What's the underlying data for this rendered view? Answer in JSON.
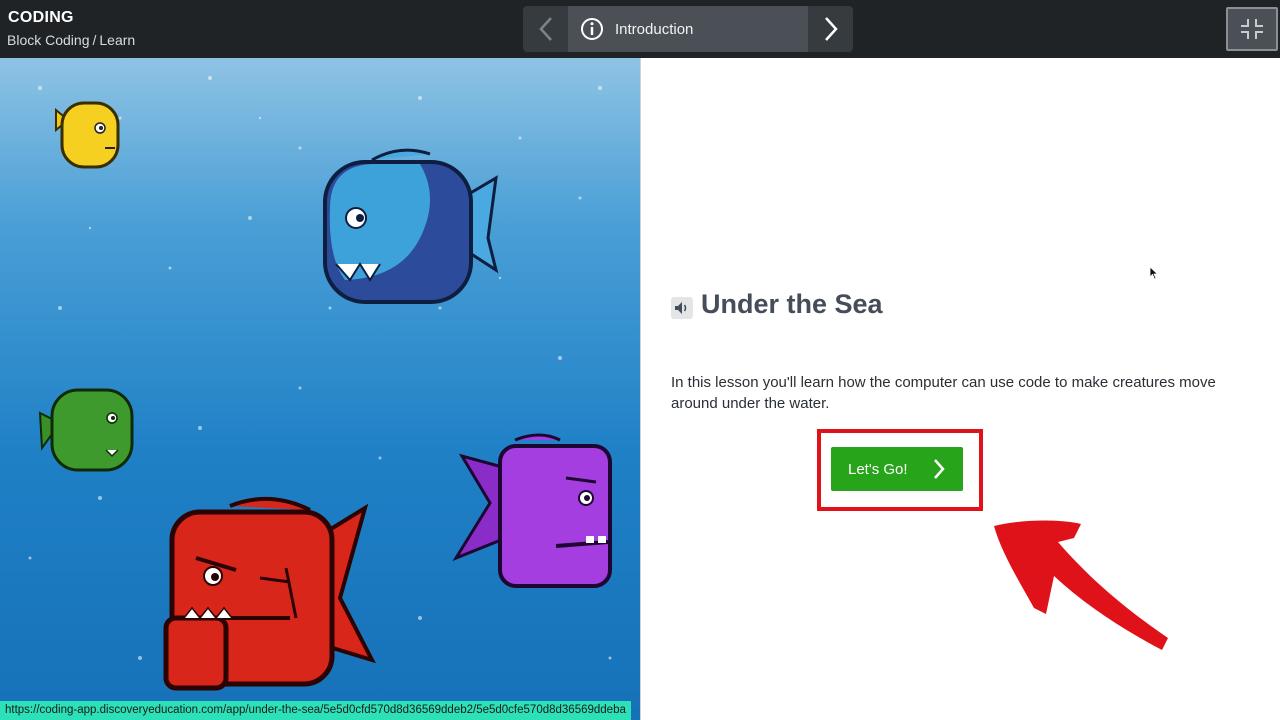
{
  "header": {
    "app_title": "CODING",
    "breadcrumb": [
      "Block Coding",
      "Learn"
    ],
    "breadcrumb_separator": "/",
    "nav_title": "Introduction",
    "icons": {
      "prev": "chevron-left-icon",
      "info": "info-icon",
      "next": "chevron-right-icon",
      "exit_fullscreen": "exit-fullscreen-icon"
    }
  },
  "stage": {
    "status_url": "https://coding-app.discoveryeducation.com/app/under-the-sea/5e5d0cfd570d8d36569ddeb2/5e5d0cfe570d8d36569ddeba",
    "characters": [
      "yellow-fish",
      "blue-fish",
      "green-fish",
      "purple-fish",
      "red-fish"
    ]
  },
  "lesson": {
    "title": "Under the Sea",
    "description": "In this lesson you'll learn how the computer can use code to make creatures move around under the water.",
    "button_label": "Let's Go!"
  },
  "colors": {
    "topbar": "#1f2326",
    "button_green": "#27a419",
    "annotation_red": "#e01219",
    "title": "#454d5a",
    "status_bar": "#2ce0b8"
  }
}
